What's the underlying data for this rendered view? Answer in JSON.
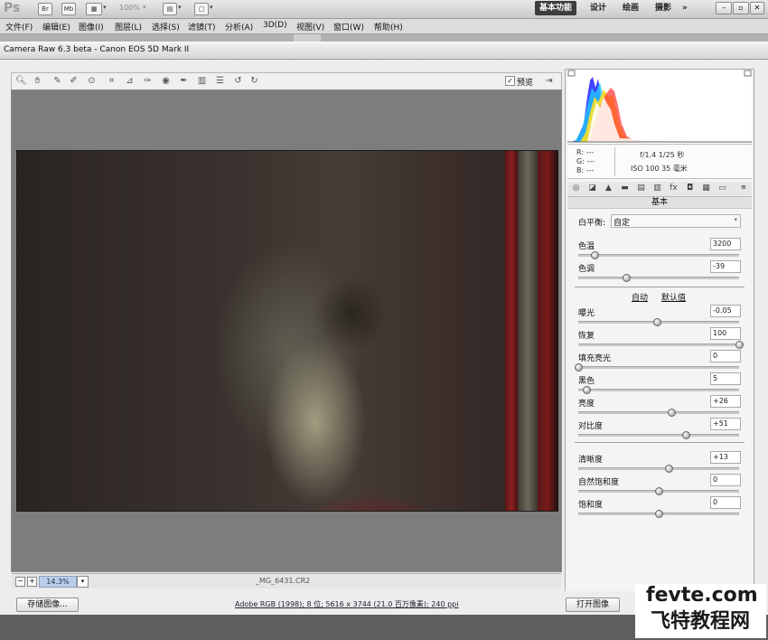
{
  "app": {
    "logo": "Ps",
    "bridge": "Br",
    "minibridge": "Mb",
    "zoom": "100%",
    "workspaces": [
      "基本功能",
      "设计",
      "绘画",
      "摄影"
    ],
    "active_workspace": "基本功能",
    "more": "»"
  },
  "menu": [
    "文件(F)",
    "编辑(E)",
    "图像(I)",
    "图层(L)",
    "选择(S)",
    "滤镜(T)",
    "分析(A)",
    "3D(D)",
    "视图(V)",
    "窗口(W)",
    "帮助(H)"
  ],
  "dialog": {
    "title": "Camera Raw 6.3 beta -  Canon EOS 5D Mark II",
    "preview_label": "预览",
    "zoom": "14.3%",
    "filename": "_MG_6431.CR2"
  },
  "info": {
    "r": "R:  ---",
    "g": "G:  ---",
    "b": "B:  ---",
    "exposure": "f/1.4  1/25 秒",
    "iso": "ISO 100  35 毫米"
  },
  "panel": {
    "title": "基本",
    "wb_label": "白平衡:",
    "wb_value": "自定",
    "auto": "自动",
    "default": "默认值",
    "sliders": [
      {
        "label": "色温",
        "value": "3200",
        "pos": 0.1
      },
      {
        "label": "色调",
        "value": "-39",
        "pos": 0.3
      },
      {
        "label": "曝光",
        "value": "-0.05",
        "pos": 0.49
      },
      {
        "label": "恢复",
        "value": "100",
        "pos": 1.0
      },
      {
        "label": "填充亮光",
        "value": "0",
        "pos": 0.0
      },
      {
        "label": "黑色",
        "value": "5",
        "pos": 0.05
      },
      {
        "label": "亮度",
        "value": "+26",
        "pos": 0.58
      },
      {
        "label": "对比度",
        "value": "+51",
        "pos": 0.67
      },
      {
        "label": "清晰度",
        "value": "+13",
        "pos": 0.56
      },
      {
        "label": "自然饱和度",
        "value": "0",
        "pos": 0.5
      },
      {
        "label": "饱和度",
        "value": "0",
        "pos": 0.5
      }
    ]
  },
  "bottom": {
    "save": "存储图像...",
    "workflow": "Adobe RGB (1998); 8 位; 5616 x 3744 (21.0 百万像素); 240 ppi",
    "open": "打开图像"
  },
  "watermark": {
    "line1": "fevte.com",
    "line2": "飞特教程网"
  }
}
